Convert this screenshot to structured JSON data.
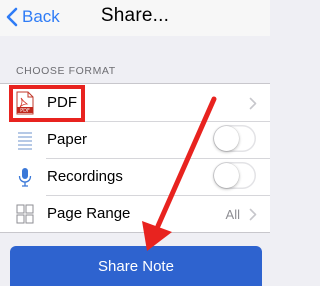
{
  "navbar": {
    "back_label": "Back",
    "title": "Share..."
  },
  "section": {
    "header": "CHOOSE FORMAT"
  },
  "rows": [
    {
      "label": "PDF",
      "icon": "pdf-icon",
      "accessory": "chevron"
    },
    {
      "label": "Paper",
      "icon": "paper-icon",
      "accessory": "toggle",
      "toggle_on": false
    },
    {
      "label": "Recordings",
      "icon": "microphone-icon",
      "accessory": "toggle",
      "toggle_on": false
    },
    {
      "label": "Page Range",
      "icon": "grid-icon",
      "accessory": "value-chevron",
      "value": "All"
    }
  ],
  "pdf_icon_text": "PDF",
  "share_button": {
    "label": "Share Note"
  },
  "colors": {
    "ios_blue": "#2f7cf6",
    "share_button": "#2e63cf",
    "annotation_red": "#e8231f",
    "background": "#efeff4"
  }
}
